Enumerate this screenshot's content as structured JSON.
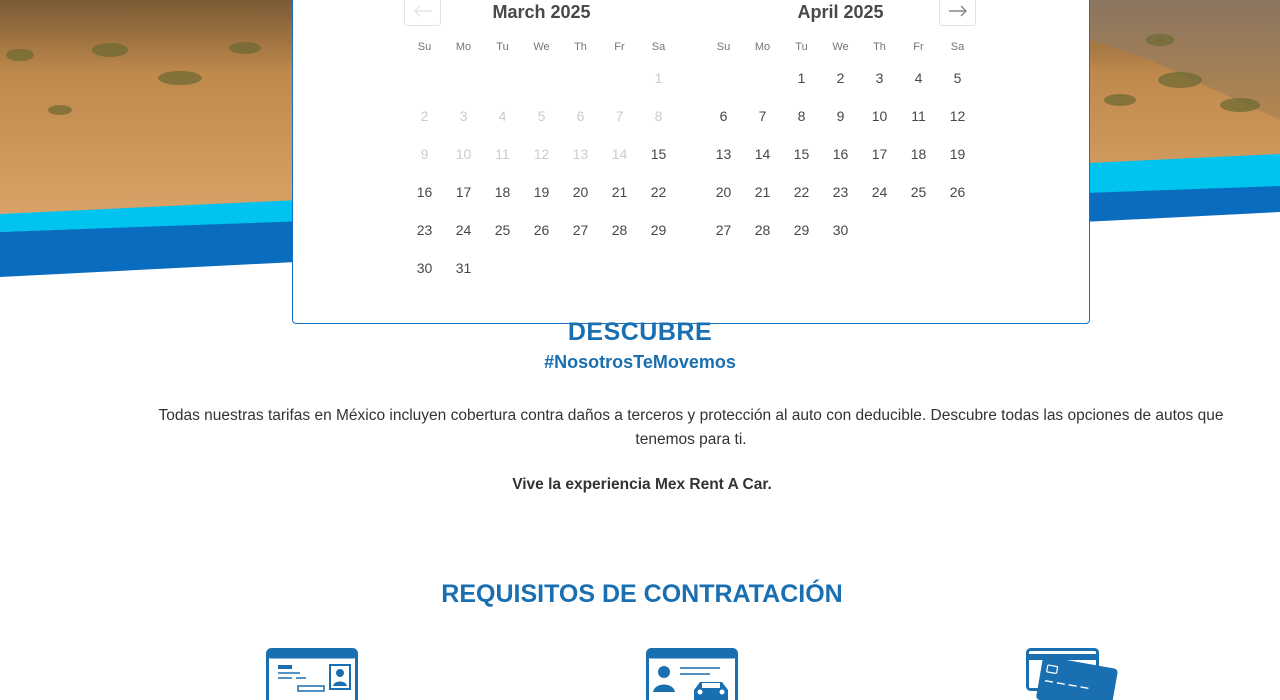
{
  "calendar": {
    "prev_label": "Previous month",
    "next_label": "Next month",
    "weekdays": [
      "Su",
      "Mo",
      "Tu",
      "We",
      "Th",
      "Fr",
      "Sa"
    ],
    "months": [
      {
        "caption": "March 2025",
        "days": [
          {
            "d": "",
            "s": "blank"
          },
          {
            "d": "",
            "s": "blank"
          },
          {
            "d": "",
            "s": "blank"
          },
          {
            "d": "",
            "s": "blank"
          },
          {
            "d": "",
            "s": "blank"
          },
          {
            "d": "",
            "s": "blank"
          },
          {
            "d": "1",
            "s": "disabled"
          },
          {
            "d": "2",
            "s": "disabled"
          },
          {
            "d": "3",
            "s": "disabled"
          },
          {
            "d": "4",
            "s": "disabled"
          },
          {
            "d": "5",
            "s": "disabled"
          },
          {
            "d": "6",
            "s": "disabled"
          },
          {
            "d": "7",
            "s": "disabled"
          },
          {
            "d": "8",
            "s": "disabled"
          },
          {
            "d": "9",
            "s": "disabled"
          },
          {
            "d": "10",
            "s": "disabled"
          },
          {
            "d": "11",
            "s": "disabled"
          },
          {
            "d": "12",
            "s": "disabled"
          },
          {
            "d": "13",
            "s": "disabled"
          },
          {
            "d": "14",
            "s": "disabled"
          },
          {
            "d": "15",
            "s": "available"
          },
          {
            "d": "16",
            "s": "available"
          },
          {
            "d": "17",
            "s": "available"
          },
          {
            "d": "18",
            "s": "available"
          },
          {
            "d": "19",
            "s": "available"
          },
          {
            "d": "20",
            "s": "available"
          },
          {
            "d": "21",
            "s": "available"
          },
          {
            "d": "22",
            "s": "available"
          },
          {
            "d": "23",
            "s": "available"
          },
          {
            "d": "24",
            "s": "available"
          },
          {
            "d": "25",
            "s": "available"
          },
          {
            "d": "26",
            "s": "available"
          },
          {
            "d": "27",
            "s": "available"
          },
          {
            "d": "28",
            "s": "available"
          },
          {
            "d": "29",
            "s": "available"
          },
          {
            "d": "30",
            "s": "available"
          },
          {
            "d": "31",
            "s": "available"
          }
        ]
      },
      {
        "caption": "April 2025",
        "days": [
          {
            "d": "",
            "s": "blank"
          },
          {
            "d": "",
            "s": "blank"
          },
          {
            "d": "1",
            "s": "available"
          },
          {
            "d": "2",
            "s": "available"
          },
          {
            "d": "3",
            "s": "available"
          },
          {
            "d": "4",
            "s": "available"
          },
          {
            "d": "5",
            "s": "available"
          },
          {
            "d": "6",
            "s": "available"
          },
          {
            "d": "7",
            "s": "available"
          },
          {
            "d": "8",
            "s": "available"
          },
          {
            "d": "9",
            "s": "available"
          },
          {
            "d": "10",
            "s": "available"
          },
          {
            "d": "11",
            "s": "available"
          },
          {
            "d": "12",
            "s": "available"
          },
          {
            "d": "13",
            "s": "available"
          },
          {
            "d": "14",
            "s": "available"
          },
          {
            "d": "15",
            "s": "available"
          },
          {
            "d": "16",
            "s": "available"
          },
          {
            "d": "17",
            "s": "available"
          },
          {
            "d": "18",
            "s": "available"
          },
          {
            "d": "19",
            "s": "available"
          },
          {
            "d": "20",
            "s": "available"
          },
          {
            "d": "21",
            "s": "available"
          },
          {
            "d": "22",
            "s": "available"
          },
          {
            "d": "23",
            "s": "available"
          },
          {
            "d": "24",
            "s": "available"
          },
          {
            "d": "25",
            "s": "available"
          },
          {
            "d": "26",
            "s": "available"
          },
          {
            "d": "27",
            "s": "available"
          },
          {
            "d": "28",
            "s": "available"
          },
          {
            "d": "29",
            "s": "available"
          },
          {
            "d": "30",
            "s": "available"
          }
        ]
      }
    ]
  },
  "descubre": {
    "title": "DESCUBRE",
    "hashtag": "#NosotrosTeMovemos",
    "body": "Todas nuestras tarifas en México incluyen cobertura contra daños a terceros y protección al auto con deducible. Descubre todas las opciones de autos que tenemos para ti.",
    "tagline": "Vive la experiencia Mex Rent A Car."
  },
  "requisitos": {
    "title": "REQUISITOS DE CONTRATACIÓN",
    "icons": [
      "id-card-icon",
      "driver-license-icon",
      "credit-card-icon"
    ]
  },
  "colors": {
    "brand_blue": "#1a6fb0",
    "stripe_cyan": "#00c3f0",
    "stripe_blue": "#0a6cbf",
    "calendar_border": "#1a73c8",
    "disabled_day": "#cacccd"
  }
}
